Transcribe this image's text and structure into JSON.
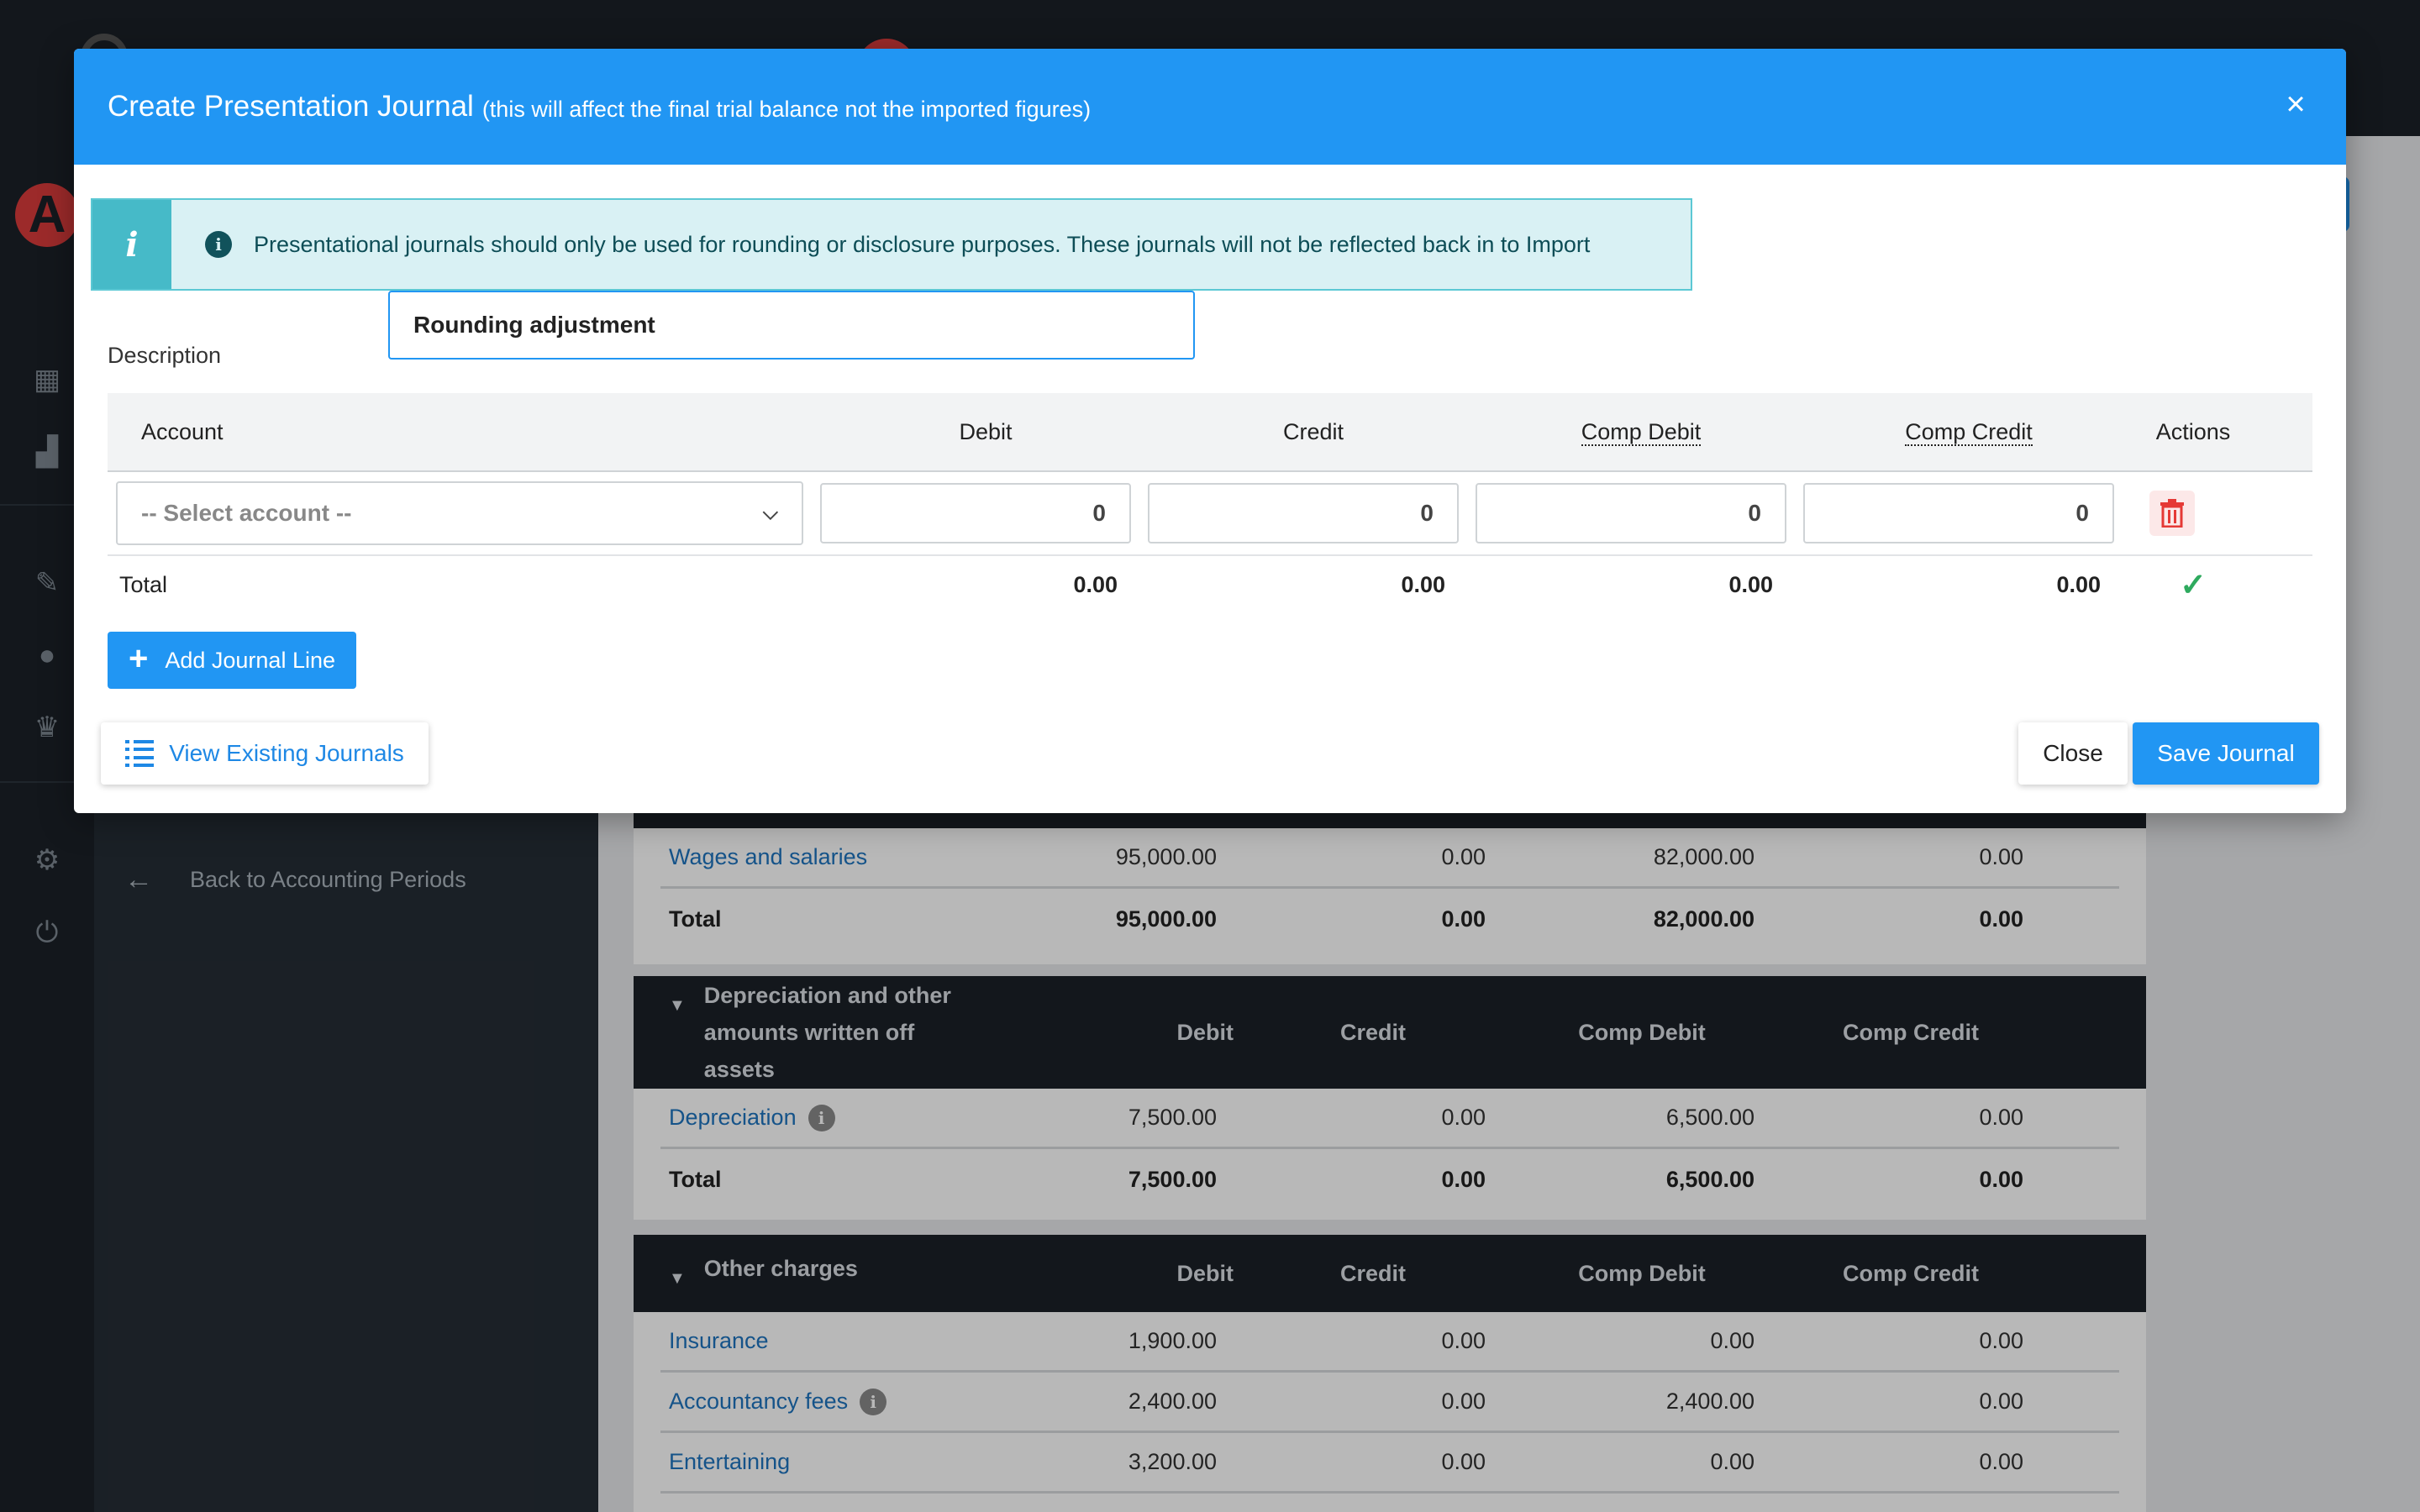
{
  "colors": {
    "primary": "#2196f3",
    "danger": "#e53935",
    "success": "#2eaa5e",
    "info": "#46bac8",
    "dark": "#1b2128"
  },
  "sidebar": {
    "back_label": "Back to Accounting Periods"
  },
  "background_sections": [
    {
      "title": "",
      "rows": [
        {
          "name": "Wages and salaries",
          "values": [
            "95,000.00",
            "0.00",
            "82,000.00",
            "0.00"
          ]
        }
      ],
      "total": {
        "label": "Total",
        "values": [
          "95,000.00",
          "0.00",
          "82,000.00",
          "0.00"
        ]
      }
    },
    {
      "title": "Depreciation and other amounts written off assets",
      "columns": [
        "Debit",
        "Credit",
        "Comp Debit",
        "Comp Credit"
      ],
      "rows": [
        {
          "name": "Depreciation",
          "values": [
            "7,500.00",
            "0.00",
            "6,500.00",
            "0.00"
          ]
        }
      ],
      "total": {
        "label": "Total",
        "values": [
          "7,500.00",
          "0.00",
          "6,500.00",
          "0.00"
        ]
      }
    },
    {
      "title": "Other charges",
      "columns": [
        "Debit",
        "Credit",
        "Comp Debit",
        "Comp Credit"
      ],
      "rows": [
        {
          "name": "Insurance",
          "values": [
            "1,900.00",
            "0.00",
            "0.00",
            "0.00"
          ]
        },
        {
          "name": "Accountancy fees",
          "values": [
            "2,400.00",
            "0.00",
            "2,400.00",
            "0.00"
          ]
        },
        {
          "name": "Entertaining",
          "values": [
            "3,200.00",
            "0.00",
            "0.00",
            "0.00"
          ]
        }
      ]
    }
  ],
  "modal": {
    "title": "Create Presentation Journal",
    "subtitle": "(this will affect the final trial balance not the imported figures)",
    "close_icon": "×",
    "alert": {
      "side_icon": "i",
      "icon": "i",
      "message": "Presentational journals should only be used for rounding or disclosure purposes. These journals will not be reflected back in to Import"
    },
    "description": {
      "label": "Description",
      "value": "Rounding adjustment"
    },
    "table": {
      "headers": {
        "account": "Account",
        "debit": "Debit",
        "credit": "Credit",
        "comp_debit": "Comp Debit",
        "comp_credit": "Comp Credit",
        "actions": "Actions"
      },
      "line": {
        "account_placeholder": "-- Select account --",
        "debit": "0",
        "credit": "0",
        "comp_debit": "0",
        "comp_credit": "0"
      },
      "totals": {
        "label": "Total",
        "debit": "0.00",
        "credit": "0.00",
        "comp_debit": "0.00",
        "comp_credit": "0.00",
        "balanced_icon": "✓"
      }
    },
    "add_line_label": "Add Journal Line",
    "view_existing_label": "View Existing Journals",
    "close_label": "Close",
    "save_label": "Save Journal"
  }
}
